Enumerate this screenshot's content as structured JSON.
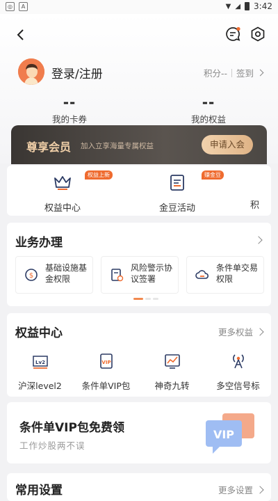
{
  "status_bar": {
    "time": "3:42"
  },
  "header": {
    "login_label": "登录/注册",
    "points_label": "积分--",
    "signin_label": "签到",
    "coupons": {
      "value": "--",
      "label": "我的卡券"
    },
    "rights": {
      "value": "--",
      "label": "我的权益"
    }
  },
  "vip_banner": {
    "title": "尊享会员",
    "subtitle": "加入立享海量专属权益",
    "button": "申请入会"
  },
  "quick_items": [
    {
      "label": "权益中心",
      "badge": "权益上新",
      "icon": "crown-icon"
    },
    {
      "label": "金豆活动",
      "badge": "赚金豆",
      "icon": "clipboard-icon"
    },
    {
      "label": "积",
      "badge": "",
      "icon": ""
    }
  ],
  "business": {
    "title": "业务办理",
    "tiles": [
      {
        "label": "基础设施基金权限",
        "icon": "dollar-circle-icon"
      },
      {
        "label": "风险警示协议签署",
        "icon": "document-warning-icon"
      },
      {
        "label": "条件单交易权限",
        "icon": "cloud-icon"
      }
    ]
  },
  "rights_center": {
    "title": "权益中心",
    "more": "更多权益",
    "items": [
      {
        "label": "沪深level2",
        "icon": "level2-icon"
      },
      {
        "label": "条件单VIP包",
        "icon": "vip-doc-icon"
      },
      {
        "label": "神奇九转",
        "icon": "chart-board-icon"
      },
      {
        "label": "多空信号标",
        "icon": "signal-tower-icon"
      }
    ]
  },
  "promo": {
    "title": "条件单VIP包免费领",
    "subtitle": "工作炒股两不误",
    "art_text": "VIP"
  },
  "common_settings": {
    "title": "常用设置",
    "more": "更多设置"
  },
  "colors": {
    "accent": "#ef6b2f",
    "gold": "#f0cfa8",
    "vip_dark": "#3a3633"
  }
}
